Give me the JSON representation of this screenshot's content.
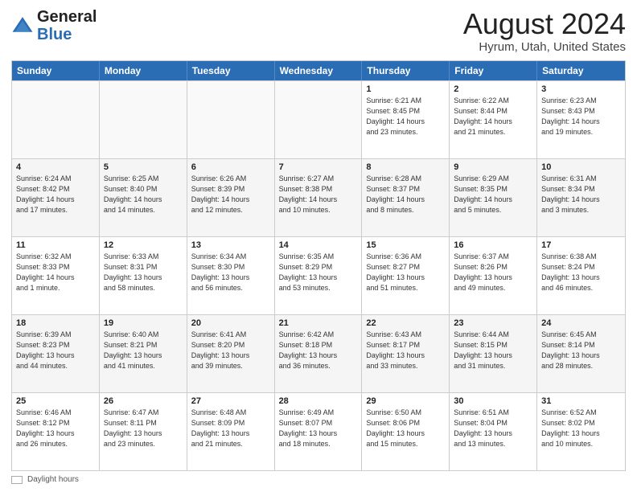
{
  "logo": {
    "general": "General",
    "blue": "Blue"
  },
  "title": {
    "main": "August 2024",
    "sub": "Hyrum, Utah, United States"
  },
  "days_of_week": [
    "Sunday",
    "Monday",
    "Tuesday",
    "Wednesday",
    "Thursday",
    "Friday",
    "Saturday"
  ],
  "weeks": [
    [
      {
        "day": "",
        "info": "",
        "empty": true
      },
      {
        "day": "",
        "info": "",
        "empty": true
      },
      {
        "day": "",
        "info": "",
        "empty": true
      },
      {
        "day": "",
        "info": "",
        "empty": true
      },
      {
        "day": "1",
        "info": "Sunrise: 6:21 AM\nSunset: 8:45 PM\nDaylight: 14 hours\nand 23 minutes.",
        "empty": false
      },
      {
        "day": "2",
        "info": "Sunrise: 6:22 AM\nSunset: 8:44 PM\nDaylight: 14 hours\nand 21 minutes.",
        "empty": false
      },
      {
        "day": "3",
        "info": "Sunrise: 6:23 AM\nSunset: 8:43 PM\nDaylight: 14 hours\nand 19 minutes.",
        "empty": false
      }
    ],
    [
      {
        "day": "4",
        "info": "Sunrise: 6:24 AM\nSunset: 8:42 PM\nDaylight: 14 hours\nand 17 minutes.",
        "empty": false
      },
      {
        "day": "5",
        "info": "Sunrise: 6:25 AM\nSunset: 8:40 PM\nDaylight: 14 hours\nand 14 minutes.",
        "empty": false
      },
      {
        "day": "6",
        "info": "Sunrise: 6:26 AM\nSunset: 8:39 PM\nDaylight: 14 hours\nand 12 minutes.",
        "empty": false
      },
      {
        "day": "7",
        "info": "Sunrise: 6:27 AM\nSunset: 8:38 PM\nDaylight: 14 hours\nand 10 minutes.",
        "empty": false
      },
      {
        "day": "8",
        "info": "Sunrise: 6:28 AM\nSunset: 8:37 PM\nDaylight: 14 hours\nand 8 minutes.",
        "empty": false
      },
      {
        "day": "9",
        "info": "Sunrise: 6:29 AM\nSunset: 8:35 PM\nDaylight: 14 hours\nand 5 minutes.",
        "empty": false
      },
      {
        "day": "10",
        "info": "Sunrise: 6:31 AM\nSunset: 8:34 PM\nDaylight: 14 hours\nand 3 minutes.",
        "empty": false
      }
    ],
    [
      {
        "day": "11",
        "info": "Sunrise: 6:32 AM\nSunset: 8:33 PM\nDaylight: 14 hours\nand 1 minute.",
        "empty": false
      },
      {
        "day": "12",
        "info": "Sunrise: 6:33 AM\nSunset: 8:31 PM\nDaylight: 13 hours\nand 58 minutes.",
        "empty": false
      },
      {
        "day": "13",
        "info": "Sunrise: 6:34 AM\nSunset: 8:30 PM\nDaylight: 13 hours\nand 56 minutes.",
        "empty": false
      },
      {
        "day": "14",
        "info": "Sunrise: 6:35 AM\nSunset: 8:29 PM\nDaylight: 13 hours\nand 53 minutes.",
        "empty": false
      },
      {
        "day": "15",
        "info": "Sunrise: 6:36 AM\nSunset: 8:27 PM\nDaylight: 13 hours\nand 51 minutes.",
        "empty": false
      },
      {
        "day": "16",
        "info": "Sunrise: 6:37 AM\nSunset: 8:26 PM\nDaylight: 13 hours\nand 49 minutes.",
        "empty": false
      },
      {
        "day": "17",
        "info": "Sunrise: 6:38 AM\nSunset: 8:24 PM\nDaylight: 13 hours\nand 46 minutes.",
        "empty": false
      }
    ],
    [
      {
        "day": "18",
        "info": "Sunrise: 6:39 AM\nSunset: 8:23 PM\nDaylight: 13 hours\nand 44 minutes.",
        "empty": false
      },
      {
        "day": "19",
        "info": "Sunrise: 6:40 AM\nSunset: 8:21 PM\nDaylight: 13 hours\nand 41 minutes.",
        "empty": false
      },
      {
        "day": "20",
        "info": "Sunrise: 6:41 AM\nSunset: 8:20 PM\nDaylight: 13 hours\nand 39 minutes.",
        "empty": false
      },
      {
        "day": "21",
        "info": "Sunrise: 6:42 AM\nSunset: 8:18 PM\nDaylight: 13 hours\nand 36 minutes.",
        "empty": false
      },
      {
        "day": "22",
        "info": "Sunrise: 6:43 AM\nSunset: 8:17 PM\nDaylight: 13 hours\nand 33 minutes.",
        "empty": false
      },
      {
        "day": "23",
        "info": "Sunrise: 6:44 AM\nSunset: 8:15 PM\nDaylight: 13 hours\nand 31 minutes.",
        "empty": false
      },
      {
        "day": "24",
        "info": "Sunrise: 6:45 AM\nSunset: 8:14 PM\nDaylight: 13 hours\nand 28 minutes.",
        "empty": false
      }
    ],
    [
      {
        "day": "25",
        "info": "Sunrise: 6:46 AM\nSunset: 8:12 PM\nDaylight: 13 hours\nand 26 minutes.",
        "empty": false
      },
      {
        "day": "26",
        "info": "Sunrise: 6:47 AM\nSunset: 8:11 PM\nDaylight: 13 hours\nand 23 minutes.",
        "empty": false
      },
      {
        "day": "27",
        "info": "Sunrise: 6:48 AM\nSunset: 8:09 PM\nDaylight: 13 hours\nand 21 minutes.",
        "empty": false
      },
      {
        "day": "28",
        "info": "Sunrise: 6:49 AM\nSunset: 8:07 PM\nDaylight: 13 hours\nand 18 minutes.",
        "empty": false
      },
      {
        "day": "29",
        "info": "Sunrise: 6:50 AM\nSunset: 8:06 PM\nDaylight: 13 hours\nand 15 minutes.",
        "empty": false
      },
      {
        "day": "30",
        "info": "Sunrise: 6:51 AM\nSunset: 8:04 PM\nDaylight: 13 hours\nand 13 minutes.",
        "empty": false
      },
      {
        "day": "31",
        "info": "Sunrise: 6:52 AM\nSunset: 8:02 PM\nDaylight: 13 hours\nand 10 minutes.",
        "empty": false
      }
    ]
  ],
  "footer": {
    "label": "Daylight hours"
  }
}
